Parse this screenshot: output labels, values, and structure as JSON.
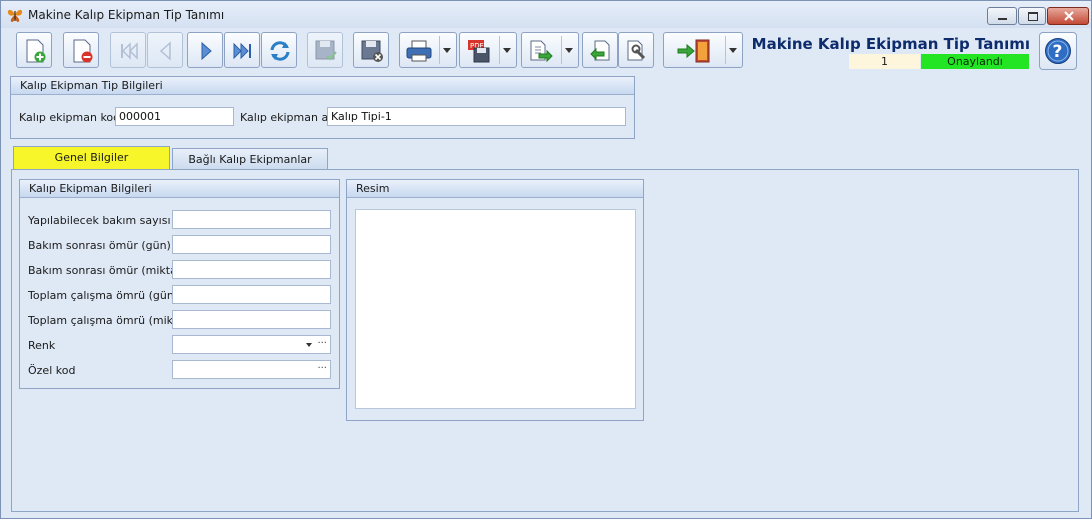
{
  "window": {
    "title": "Makine Kalıp Ekipman Tip Tanımı"
  },
  "toolbar": {
    "buttons": [
      {
        "name": "new-record",
        "icon": "new-document-icon"
      },
      {
        "name": "delete-record",
        "icon": "delete-document-icon"
      },
      {
        "name": "first-record",
        "icon": "first-icon"
      },
      {
        "name": "previous-record",
        "icon": "previous-icon"
      },
      {
        "name": "next-record",
        "icon": "next-icon"
      },
      {
        "name": "last-record",
        "icon": "last-icon"
      },
      {
        "name": "refresh",
        "icon": "refresh-icon"
      },
      {
        "name": "save-approve",
        "icon": "save-check-icon"
      },
      {
        "name": "save-cancel",
        "icon": "save-cancel-icon"
      },
      {
        "name": "print",
        "icon": "printer-icon"
      },
      {
        "name": "export-pdf",
        "icon": "pdf-save-icon"
      },
      {
        "name": "export-document",
        "icon": "export-document-icon"
      },
      {
        "name": "import",
        "icon": "import-icon"
      },
      {
        "name": "settings",
        "icon": "wrench-document-icon"
      },
      {
        "name": "exit",
        "icon": "exit-door-icon"
      }
    ]
  },
  "header": {
    "form_title": "Makine Kalıp Ekipman Tip Tanımı",
    "record_number": "1",
    "status": "Onaylandı",
    "status_color": "#23e523"
  },
  "info_group": {
    "title": "Kalıp Ekipman Tip Bilgileri",
    "code_label": "Kalıp ekipman kodu",
    "code_value": "000001",
    "name_label": "Kalıp ekipman adı",
    "name_value": "Kalıp Tipi-1"
  },
  "tabs": [
    {
      "label": "Genel Bilgiler",
      "active": true
    },
    {
      "label": "Bağlı Kalıp Ekipmanlar",
      "active": false
    }
  ],
  "details_group": {
    "title": "Kalıp Ekipman Bilgileri",
    "fields": [
      {
        "label": "Yapılabilecek bakım sayısı",
        "value": ""
      },
      {
        "label": "Bakım sonrası ömür (gün)",
        "value": ""
      },
      {
        "label": "Bakım sonrası ömür (miktar)",
        "value": ""
      },
      {
        "label": "Toplam çalışma ömrü (gün)",
        "value": ""
      },
      {
        "label": "Toplam çalışma ömrü (miktar)",
        "value": ""
      },
      {
        "label": "Renk",
        "value": ""
      },
      {
        "label": "Özel kod",
        "value": ""
      }
    ]
  },
  "picture_group": {
    "title": "Resim"
  }
}
